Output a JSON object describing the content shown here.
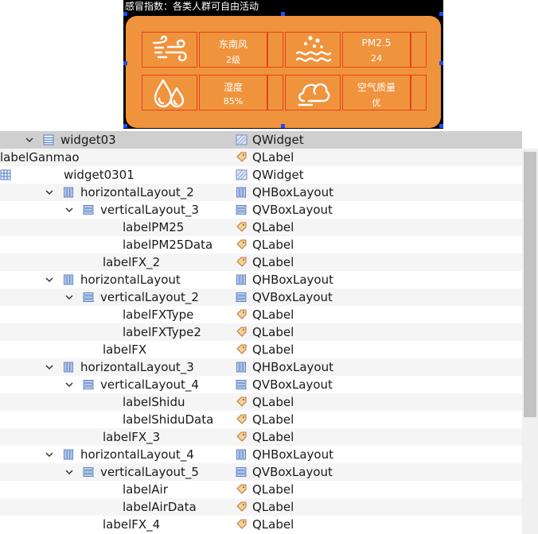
{
  "preview": {
    "title": "感冒指数：各类人群可自由活动",
    "cards": [
      {
        "icon": "wind-icon",
        "line1": "东南风",
        "line2": "2级"
      },
      {
        "icon": "pm25-icon",
        "line1": "PM2.5",
        "line2": "24"
      },
      {
        "icon": "humidity-icon",
        "line1": "湿度",
        "line2": "85%"
      },
      {
        "icon": "cloud-icon",
        "line1": "空气质量",
        "line2": "优"
      }
    ],
    "colors": {
      "panel": "#f0933d",
      "border": "#e3421c",
      "text": "#ffffff",
      "background": "#000000"
    }
  },
  "tree": {
    "rows": [
      {
        "name": "widget03",
        "cls": "QWidget",
        "expandable": true,
        "icon": "widget-stack-icon",
        "class_icon": "qwidget-icon",
        "selected": true
      },
      {
        "name": "labelGanmao",
        "cls": "QLabel",
        "expandable": false,
        "icon": "",
        "class_icon": "qlabel-icon"
      },
      {
        "name": "widget0301",
        "cls": "QWidget",
        "expandable": true,
        "icon": "grid-layout-icon",
        "class_icon": "qwidget-icon"
      },
      {
        "name": "horizontalLayout_2",
        "cls": "QHBoxLayout",
        "expandable": true,
        "icon": "hbox-layout-icon",
        "class_icon": "hbox-layout-icon"
      },
      {
        "name": "verticalLayout_3",
        "cls": "QVBoxLayout",
        "expandable": true,
        "icon": "vbox-layout-icon",
        "class_icon": "vbox-layout-icon"
      },
      {
        "name": "labelPM25",
        "cls": "QLabel",
        "expandable": false,
        "icon": "",
        "class_icon": "qlabel-icon"
      },
      {
        "name": "labelPM25Data",
        "cls": "QLabel",
        "expandable": false,
        "icon": "",
        "class_icon": "qlabel-icon"
      },
      {
        "name": "labelFX_2",
        "cls": "QLabel",
        "expandable": false,
        "icon": "",
        "class_icon": "qlabel-icon"
      },
      {
        "name": "horizontalLayout",
        "cls": "QHBoxLayout",
        "expandable": true,
        "icon": "hbox-layout-icon",
        "class_icon": "hbox-layout-icon"
      },
      {
        "name": "verticalLayout_2",
        "cls": "QVBoxLayout",
        "expandable": true,
        "icon": "vbox-layout-icon",
        "class_icon": "vbox-layout-icon"
      },
      {
        "name": "labelFXType",
        "cls": "QLabel",
        "expandable": false,
        "icon": "",
        "class_icon": "qlabel-icon"
      },
      {
        "name": "labelFXType2",
        "cls": "QLabel",
        "expandable": false,
        "icon": "",
        "class_icon": "qlabel-icon"
      },
      {
        "name": "labelFX",
        "cls": "QLabel",
        "expandable": false,
        "icon": "",
        "class_icon": "qlabel-icon"
      },
      {
        "name": "horizontalLayout_3",
        "cls": "QHBoxLayout",
        "expandable": true,
        "icon": "hbox-layout-icon",
        "class_icon": "hbox-layout-icon"
      },
      {
        "name": "verticalLayout_4",
        "cls": "QVBoxLayout",
        "expandable": true,
        "icon": "vbox-layout-icon",
        "class_icon": "vbox-layout-icon"
      },
      {
        "name": "labelShidu",
        "cls": "QLabel",
        "expandable": false,
        "icon": "",
        "class_icon": "qlabel-icon"
      },
      {
        "name": "labelShiduData",
        "cls": "QLabel",
        "expandable": false,
        "icon": "",
        "class_icon": "qlabel-icon"
      },
      {
        "name": "labelFX_3",
        "cls": "QLabel",
        "expandable": false,
        "icon": "",
        "class_icon": "qlabel-icon"
      },
      {
        "name": "horizontalLayout_4",
        "cls": "QHBoxLayout",
        "expandable": true,
        "icon": "hbox-layout-icon",
        "class_icon": "hbox-layout-icon"
      },
      {
        "name": "verticalLayout_5",
        "cls": "QVBoxLayout",
        "expandable": true,
        "icon": "vbox-layout-icon",
        "class_icon": "vbox-layout-icon"
      },
      {
        "name": "labelAir",
        "cls": "QLabel",
        "expandable": false,
        "icon": "",
        "class_icon": "qlabel-icon"
      },
      {
        "name": "labelAirData",
        "cls": "QLabel",
        "expandable": false,
        "icon": "",
        "class_icon": "qlabel-icon"
      },
      {
        "name": "labelFX_4",
        "cls": "QLabel",
        "expandable": false,
        "icon": "",
        "class_icon": "qlabel-icon"
      }
    ]
  }
}
